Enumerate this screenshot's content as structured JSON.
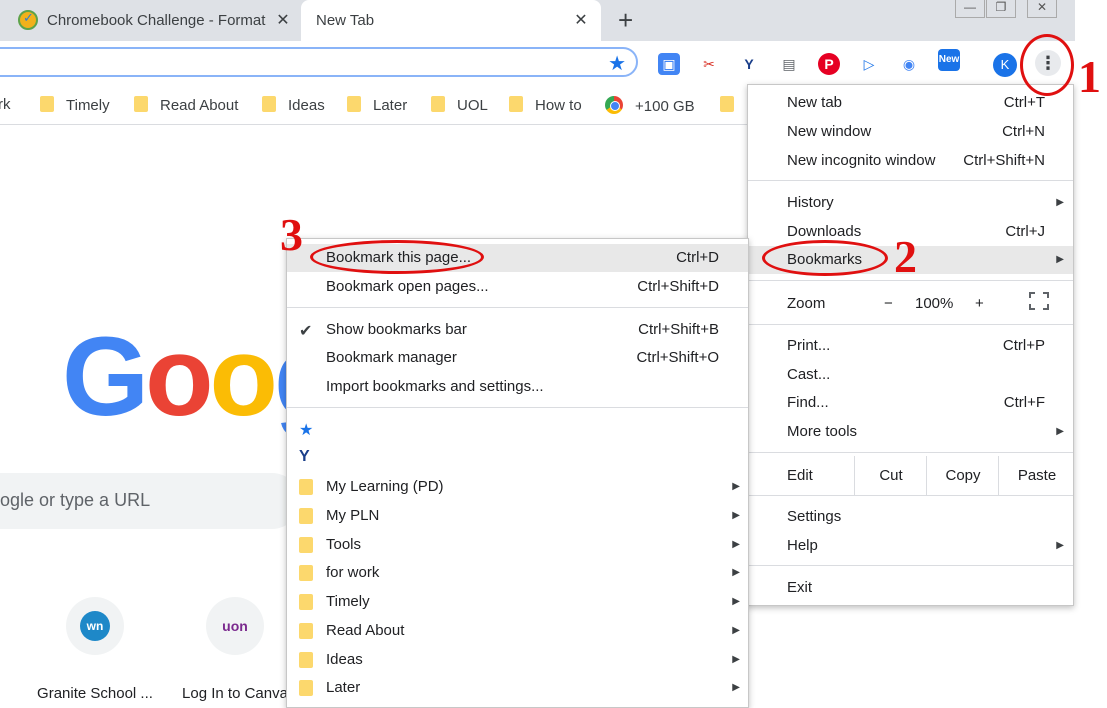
{
  "tabs": [
    {
      "title": "Chromebook Challenge - Format",
      "close": "✕"
    },
    {
      "title": "New Tab",
      "close": "✕"
    }
  ],
  "new_tab_button": "+",
  "window_controls": [
    "—",
    "❐",
    "✕"
  ],
  "toolbar": {
    "avatar_letter": "K",
    "menu_button": "⋮",
    "new_badge": "New"
  },
  "bookmarks_bar": [
    {
      "label": "rk",
      "icon": "folder-icon"
    },
    {
      "label": "Timely",
      "icon": "folder-icon"
    },
    {
      "label": "Read About",
      "icon": "folder-icon"
    },
    {
      "label": "Ideas",
      "icon": "folder-icon"
    },
    {
      "label": "Later",
      "icon": "folder-icon"
    },
    {
      "label": "UOL",
      "icon": "folder-icon"
    },
    {
      "label": "How to",
      "icon": "folder-icon"
    },
    {
      "label": "+100 GB",
      "icon": "chrome-icon"
    }
  ],
  "page": {
    "logo_letters": [
      "G",
      "o",
      "o",
      "g"
    ],
    "logo_colors": [
      "#4285f4",
      "#ea4335",
      "#fbbc05",
      "#4285f4"
    ],
    "search_placeholder": "ogle or type a URL",
    "tiles": [
      {
        "label": "Granite School ...",
        "icon_text": "wn"
      },
      {
        "label": "Log In to Canva",
        "icon_text": "uon"
      }
    ]
  },
  "main_menu": {
    "new_tab": {
      "label": "New tab",
      "shortcut": "Ctrl+T"
    },
    "new_window": {
      "label": "New window",
      "shortcut": "Ctrl+N"
    },
    "new_incognito": {
      "label": "New incognito window",
      "shortcut": "Ctrl+Shift+N"
    },
    "history": {
      "label": "History"
    },
    "downloads": {
      "label": "Downloads",
      "shortcut": "Ctrl+J"
    },
    "bookmarks": {
      "label": "Bookmarks"
    },
    "zoom": {
      "label": "Zoom",
      "minus": "−",
      "value": "100%",
      "plus": "+"
    },
    "print": {
      "label": "Print...",
      "shortcut": "Ctrl+P"
    },
    "cast": {
      "label": "Cast..."
    },
    "find": {
      "label": "Find...",
      "shortcut": "Ctrl+F"
    },
    "more_tools": {
      "label": "More tools"
    },
    "edit": {
      "label": "Edit",
      "cut": "Cut",
      "copy": "Copy",
      "paste": "Paste"
    },
    "settings": {
      "label": "Settings"
    },
    "help": {
      "label": "Help"
    },
    "exit": {
      "label": "Exit"
    }
  },
  "bookmarks_submenu": {
    "bookmark_page": {
      "label": "Bookmark this page...",
      "shortcut": "Ctrl+D"
    },
    "bookmark_open": {
      "label": "Bookmark open pages...",
      "shortcut": "Ctrl+Shift+D"
    },
    "show_bar": {
      "label": "Show bookmarks bar",
      "shortcut": "Ctrl+Shift+B",
      "check": "✔"
    },
    "manager": {
      "label": "Bookmark manager",
      "shortcut": "Ctrl+Shift+O"
    },
    "import": {
      "label": "Import bookmarks and settings..."
    },
    "folders": [
      "My Learning (PD)",
      "My PLN",
      "Tools",
      "for work",
      "Timely",
      "Read About",
      "Ideas",
      "Later"
    ]
  },
  "annotations": [
    "1",
    "2",
    "3"
  ],
  "colors": {
    "annotation_red": "#e01010",
    "menu_highlight": "#e8e8e8",
    "folder_yellow": "#fcd86d"
  }
}
